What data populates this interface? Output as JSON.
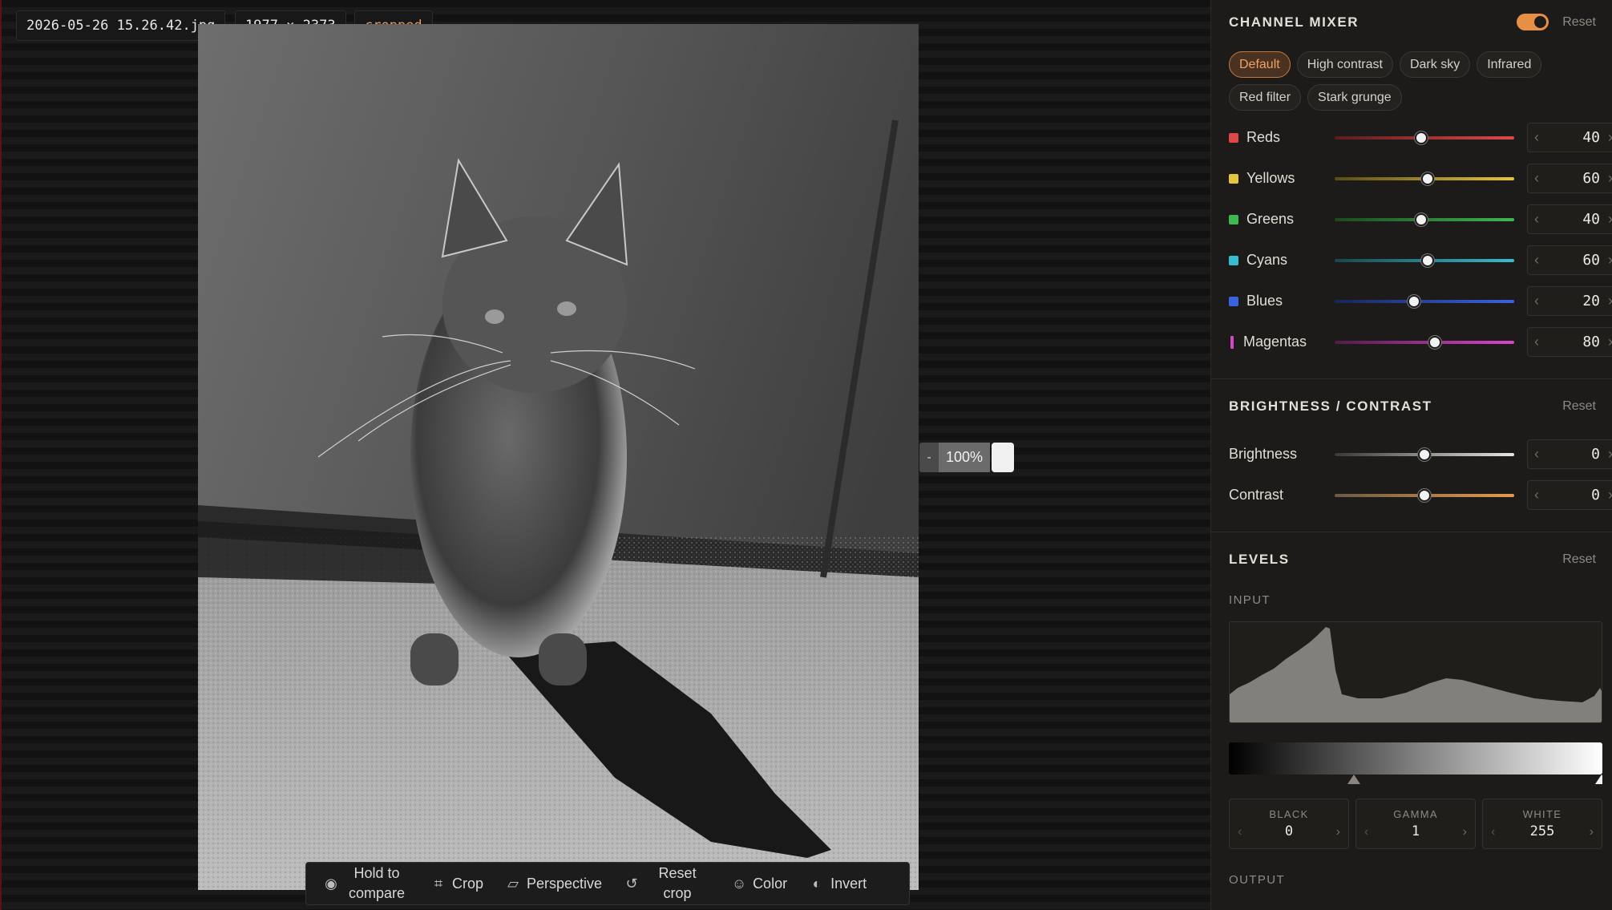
{
  "canvas": {
    "file_name": "2026-05-26 15.26.42.jpg",
    "dimensions": "1977 × 2373",
    "crop_badge": "cropped",
    "zoom": {
      "minus": "-",
      "value": "100%"
    },
    "toolbar": [
      {
        "id": "compare",
        "icon": "eye-icon",
        "glyph": "◉",
        "label": "Hold to compare"
      },
      {
        "id": "crop",
        "icon": "crop-icon",
        "glyph": "⌗",
        "label": "Crop"
      },
      {
        "id": "perspective",
        "icon": "perspective-icon",
        "glyph": "▱",
        "label": "Perspective"
      },
      {
        "id": "reset-crop",
        "icon": "undo-icon",
        "glyph": "↺",
        "label": "Reset crop"
      },
      {
        "id": "color",
        "icon": "palette-icon",
        "glyph": "☺",
        "label": "Color"
      },
      {
        "id": "invert",
        "icon": "invert-icon",
        "glyph": "◐",
        "label": "Invert"
      }
    ]
  },
  "channel_mixer": {
    "title": "CHANNEL MIXER",
    "reset": "Reset",
    "enabled": true,
    "accent": "#e78f45",
    "presets": [
      "Default",
      "High contrast",
      "Dark sky",
      "Infrared",
      "Red filter",
      "Stark grunge"
    ],
    "active_preset": "Default",
    "channels": [
      {
        "label": "Reds",
        "value": "40",
        "color": "#e04848",
        "track": [
          "#5b1c1c",
          "#e04848"
        ],
        "pos": 0.48
      },
      {
        "label": "Yellows",
        "value": "60",
        "color": "#e6c53a",
        "track": [
          "#5a4d16",
          "#e6c53a"
        ],
        "pos": 0.52
      },
      {
        "label": "Greens",
        "value": "40",
        "color": "#3fb850",
        "track": [
          "#1a4a20",
          "#3fb850"
        ],
        "pos": 0.48
      },
      {
        "label": "Cyans",
        "value": "60",
        "color": "#38bcd0",
        "track": [
          "#17474e",
          "#38bcd0"
        ],
        "pos": 0.52
      },
      {
        "label": "Blues",
        "value": "20",
        "color": "#3a62e0",
        "track": [
          "#182657",
          "#3a62e0"
        ],
        "pos": 0.44
      },
      {
        "label": "Magentas",
        "value": "80",
        "color": "#d846c8",
        "track": [
          "#541a4d",
          "#d846c8"
        ],
        "pos": 0.56
      }
    ]
  },
  "brightness_contrast": {
    "title": "BRIGHTNESS / CONTRAST",
    "reset": "Reset",
    "rows": [
      {
        "label": "Brightness",
        "value": "0",
        "track": [
          "#3a3935",
          "#e8e6e0"
        ],
        "pos": 0.5
      },
      {
        "label": "Contrast",
        "value": "0",
        "track": [
          "#6b5a45",
          "#e89a4c"
        ],
        "pos": 0.5
      }
    ]
  },
  "levels": {
    "title": "LEVELS",
    "reset": "Reset",
    "input_label": "INPUT",
    "output_label": "OUTPUT",
    "black_label": "BLACK",
    "black_value": "0",
    "gamma_label": "GAMMA",
    "gamma_value": "1",
    "white_label": "WHITE",
    "white_value": "255"
  },
  "glyphs": {
    "prev": "‹",
    "next": "›"
  }
}
